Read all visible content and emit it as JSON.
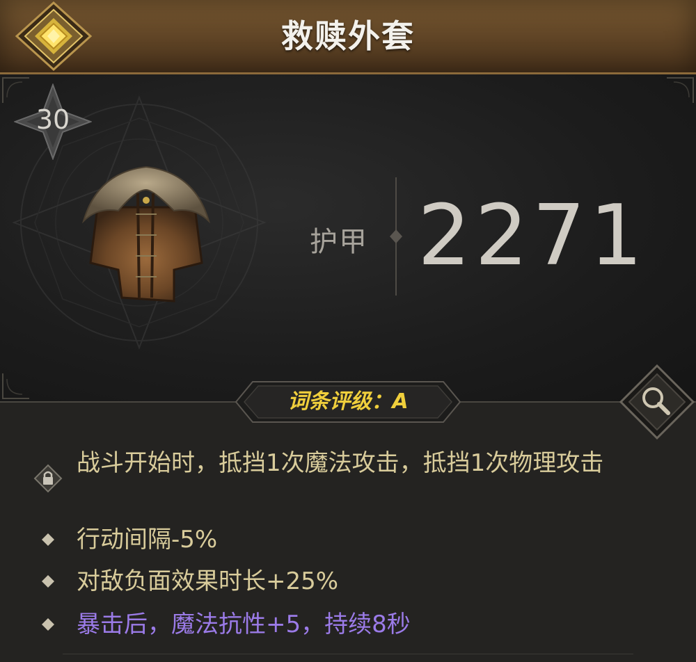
{
  "item": {
    "name": "救赎外套",
    "level": "30",
    "rank_icon": "gold-diamond-rank-icon",
    "art_icon": "fur-coat-armor-icon"
  },
  "stats": {
    "armor_label": "护甲",
    "armor_value": "2271"
  },
  "grade": {
    "text": "词条评级：A"
  },
  "affixes": [
    {
      "text": "战斗开始时，抵挡1次魔法攻击，抵挡1次物理攻击",
      "icon": "lock-icon",
      "color": "#d9cc9b"
    },
    {
      "text": "行动间隔-5%",
      "icon": "diamond-bullet-icon",
      "color": "#d9cc9b"
    },
    {
      "text": "对敌负面效果时长+25%",
      "icon": "diamond-bullet-icon",
      "color": "#d9cc9b"
    },
    {
      "text": "暴击后，魔法抗性+5，持续8秒",
      "icon": "diamond-bullet-icon",
      "color": "#9b7be8"
    }
  ],
  "colors": {
    "header": "#6a4c2b",
    "grade_gold": "#f0cf3c",
    "affix_gold": "#d9cc9b",
    "affix_purple": "#9b7be8"
  }
}
